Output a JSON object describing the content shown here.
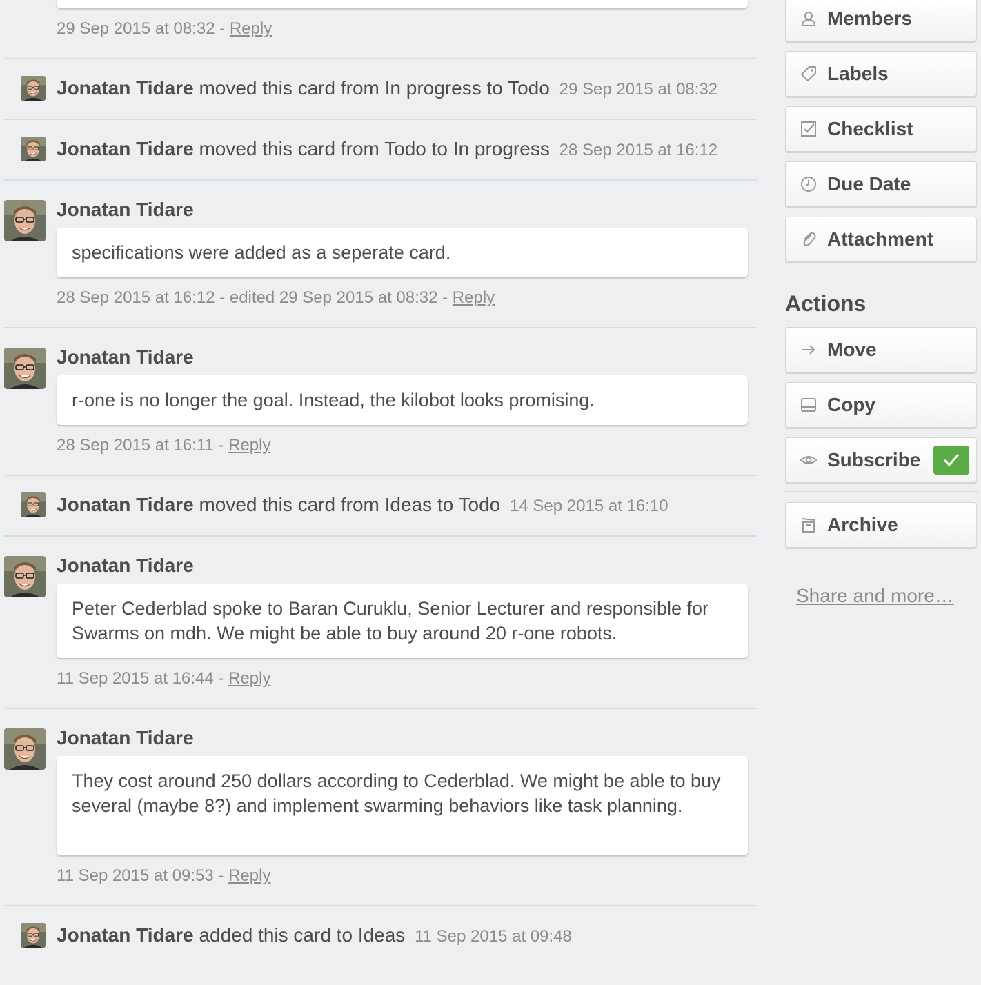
{
  "user": {
    "name": "Jonatan Tidare"
  },
  "feed": {
    "reply_label": "Reply",
    "entries": [
      {
        "type": "comment_tail",
        "meta_prefix": "29 Sep 2015 at 08:32 - "
      },
      {
        "type": "action",
        "text": "moved this card from In progress to Todo",
        "time": "29 Sep 2015 at 08:32"
      },
      {
        "type": "action",
        "text": "moved this card from Todo to In progress",
        "time": "28 Sep 2015 at 16:12"
      },
      {
        "type": "comment",
        "body": "specifications were added as a seperate card.",
        "meta_prefix": "28 Sep 2015 at 16:12 - edited 29 Sep 2015 at 08:32 - "
      },
      {
        "type": "comment",
        "body": "r-one is no longer the goal. Instead, the kilobot looks promising.",
        "meta_prefix": "28 Sep 2015 at 16:11 - "
      },
      {
        "type": "action",
        "text": "moved this card from Ideas to Todo",
        "time": "14 Sep 2015 at 16:10"
      },
      {
        "type": "comment",
        "body": "Peter Cederblad spoke to Baran Curuklu, Senior Lecturer and responsible for Swarms on mdh. We might be able to buy around 20 r-one robots.",
        "meta_prefix": "11 Sep 2015 at 16:44 - "
      },
      {
        "type": "comment",
        "body": "They cost around 250 dollars according to Cederblad. We might be able to buy several (maybe 8?) and implement swarming behaviors like task planning.",
        "meta_prefix": "11 Sep 2015 at 09:53 - "
      },
      {
        "type": "action",
        "text": "added this card to Ideas",
        "time": "11 Sep 2015 at 09:48"
      }
    ]
  },
  "sidebar": {
    "add_buttons": [
      {
        "label": "Members",
        "icon": "person-icon"
      },
      {
        "label": "Labels",
        "icon": "tag-icon"
      },
      {
        "label": "Checklist",
        "icon": "checkbox-icon"
      },
      {
        "label": "Due Date",
        "icon": "clock-icon"
      },
      {
        "label": "Attachment",
        "icon": "paperclip-icon"
      }
    ],
    "actions_heading": "Actions",
    "action_buttons": [
      {
        "label": "Move",
        "icon": "arrow-right-icon"
      },
      {
        "label": "Copy",
        "icon": "copy-icon"
      },
      {
        "label": "Subscribe",
        "icon": "eye-icon",
        "checked": true
      },
      {
        "label": "Archive",
        "icon": "archive-icon"
      }
    ],
    "share_label": "Share and more…"
  },
  "colors": {
    "background": "#edeff0",
    "subscribed_badge": "#5aac44",
    "text": "#4d4d4d",
    "muted": "#8c8c8c"
  }
}
